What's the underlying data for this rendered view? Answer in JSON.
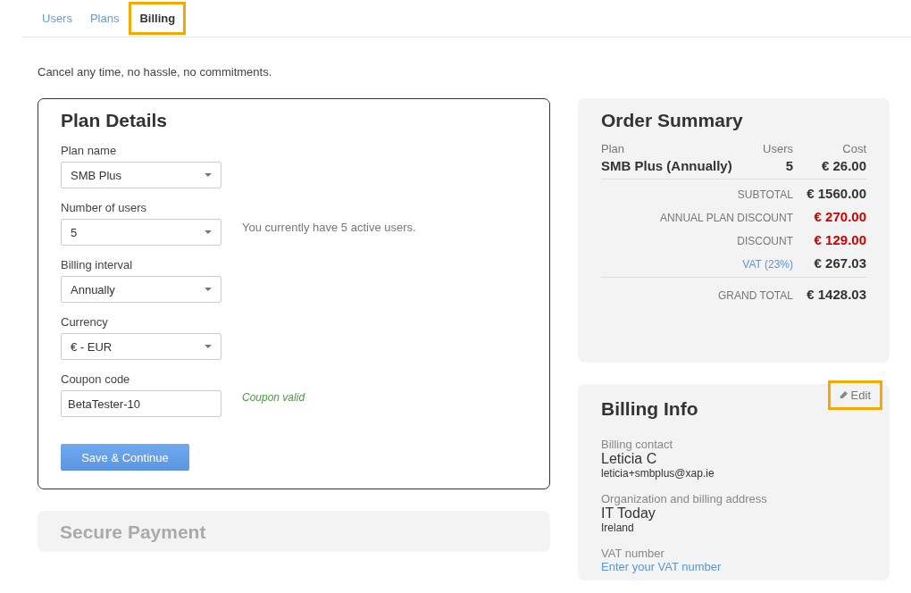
{
  "tabs": [
    {
      "label": "Users",
      "selected": false,
      "highlighted": false
    },
    {
      "label": "Plans",
      "selected": false,
      "highlighted": false
    },
    {
      "label": "Billing",
      "selected": true,
      "highlighted": true
    }
  ],
  "intro": "Cancel any time, no hassle, no commitments.",
  "plan_details": {
    "title": "Plan Details",
    "fields": [
      {
        "kind": "select",
        "label": "Plan name",
        "value": "SMB Plus"
      },
      {
        "kind": "select",
        "label": "Number of users",
        "value": "5",
        "note": {
          "text": "You currently have 5 active users.",
          "kind": "info"
        }
      },
      {
        "kind": "select",
        "label": "Billing interval",
        "value": "Annually"
      },
      {
        "kind": "select",
        "label": "Currency",
        "value": "€ - EUR"
      },
      {
        "kind": "text",
        "label": "Coupon code",
        "value": "BetaTester-10",
        "note": {
          "text": "Coupon valid",
          "kind": "success"
        }
      }
    ],
    "button": "Save & Continue"
  },
  "order_summary": {
    "title": "Order Summary",
    "columns": [
      "Plan",
      "Users",
      "Cost"
    ],
    "items": [
      {
        "plan": "SMB Plus (Annually)",
        "users": "5",
        "cost": "€ 26.00"
      }
    ],
    "totals": [
      {
        "label": "SUBTOTAL",
        "value": "€ 1560.00",
        "kind": "normal"
      },
      {
        "label": "ANNUAL PLAN DISCOUNT",
        "value": "€ 270.00",
        "kind": "discount"
      },
      {
        "label": "DISCOUNT",
        "value": "€ 129.00",
        "kind": "discount"
      },
      {
        "label": "VAT (23%)",
        "value": "€ 267.03",
        "kind": "link"
      }
    ],
    "grand_total": {
      "label": "GRAND TOTAL",
      "value": "€ 1428.03"
    }
  },
  "billing_info": {
    "title": "Billing Info",
    "edit": {
      "label": "Edit",
      "highlighted": true
    },
    "sections": [
      {
        "label": "Billing contact",
        "lines": [
          {
            "text": "Leticia C",
            "kind": "primary"
          },
          {
            "text": "leticia+smbplus@xap.ie",
            "kind": "secondary"
          }
        ]
      },
      {
        "label": "Organization and billing address",
        "lines": [
          {
            "text": "IT Today",
            "kind": "primary"
          },
          {
            "text": "Ireland",
            "kind": "secondary"
          }
        ]
      },
      {
        "label": "VAT number",
        "lines": [
          {
            "text": "Enter your VAT number",
            "kind": "link"
          }
        ]
      }
    ]
  },
  "secure_payment": {
    "title": "Secure Payment"
  }
}
